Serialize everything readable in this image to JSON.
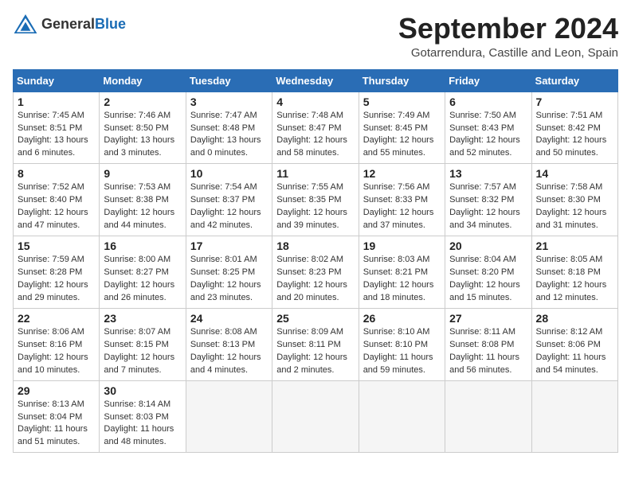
{
  "header": {
    "logo_general": "General",
    "logo_blue": "Blue",
    "month_title": "September 2024",
    "location": "Gotarrendura, Castille and Leon, Spain"
  },
  "calendar": {
    "headers": [
      "Sunday",
      "Monday",
      "Tuesday",
      "Wednesday",
      "Thursday",
      "Friday",
      "Saturday"
    ],
    "weeks": [
      [
        {
          "day": "1",
          "text": "Sunrise: 7:45 AM\nSunset: 8:51 PM\nDaylight: 13 hours\nand 6 minutes."
        },
        {
          "day": "2",
          "text": "Sunrise: 7:46 AM\nSunset: 8:50 PM\nDaylight: 13 hours\nand 3 minutes."
        },
        {
          "day": "3",
          "text": "Sunrise: 7:47 AM\nSunset: 8:48 PM\nDaylight: 13 hours\nand 0 minutes."
        },
        {
          "day": "4",
          "text": "Sunrise: 7:48 AM\nSunset: 8:47 PM\nDaylight: 12 hours\nand 58 minutes."
        },
        {
          "day": "5",
          "text": "Sunrise: 7:49 AM\nSunset: 8:45 PM\nDaylight: 12 hours\nand 55 minutes."
        },
        {
          "day": "6",
          "text": "Sunrise: 7:50 AM\nSunset: 8:43 PM\nDaylight: 12 hours\nand 52 minutes."
        },
        {
          "day": "7",
          "text": "Sunrise: 7:51 AM\nSunset: 8:42 PM\nDaylight: 12 hours\nand 50 minutes."
        }
      ],
      [
        {
          "day": "8",
          "text": "Sunrise: 7:52 AM\nSunset: 8:40 PM\nDaylight: 12 hours\nand 47 minutes."
        },
        {
          "day": "9",
          "text": "Sunrise: 7:53 AM\nSunset: 8:38 PM\nDaylight: 12 hours\nand 44 minutes."
        },
        {
          "day": "10",
          "text": "Sunrise: 7:54 AM\nSunset: 8:37 PM\nDaylight: 12 hours\nand 42 minutes."
        },
        {
          "day": "11",
          "text": "Sunrise: 7:55 AM\nSunset: 8:35 PM\nDaylight: 12 hours\nand 39 minutes."
        },
        {
          "day": "12",
          "text": "Sunrise: 7:56 AM\nSunset: 8:33 PM\nDaylight: 12 hours\nand 37 minutes."
        },
        {
          "day": "13",
          "text": "Sunrise: 7:57 AM\nSunset: 8:32 PM\nDaylight: 12 hours\nand 34 minutes."
        },
        {
          "day": "14",
          "text": "Sunrise: 7:58 AM\nSunset: 8:30 PM\nDaylight: 12 hours\nand 31 minutes."
        }
      ],
      [
        {
          "day": "15",
          "text": "Sunrise: 7:59 AM\nSunset: 8:28 PM\nDaylight: 12 hours\nand 29 minutes."
        },
        {
          "day": "16",
          "text": "Sunrise: 8:00 AM\nSunset: 8:27 PM\nDaylight: 12 hours\nand 26 minutes."
        },
        {
          "day": "17",
          "text": "Sunrise: 8:01 AM\nSunset: 8:25 PM\nDaylight: 12 hours\nand 23 minutes."
        },
        {
          "day": "18",
          "text": "Sunrise: 8:02 AM\nSunset: 8:23 PM\nDaylight: 12 hours\nand 20 minutes."
        },
        {
          "day": "19",
          "text": "Sunrise: 8:03 AM\nSunset: 8:21 PM\nDaylight: 12 hours\nand 18 minutes."
        },
        {
          "day": "20",
          "text": "Sunrise: 8:04 AM\nSunset: 8:20 PM\nDaylight: 12 hours\nand 15 minutes."
        },
        {
          "day": "21",
          "text": "Sunrise: 8:05 AM\nSunset: 8:18 PM\nDaylight: 12 hours\nand 12 minutes."
        }
      ],
      [
        {
          "day": "22",
          "text": "Sunrise: 8:06 AM\nSunset: 8:16 PM\nDaylight: 12 hours\nand 10 minutes."
        },
        {
          "day": "23",
          "text": "Sunrise: 8:07 AM\nSunset: 8:15 PM\nDaylight: 12 hours\nand 7 minutes."
        },
        {
          "day": "24",
          "text": "Sunrise: 8:08 AM\nSunset: 8:13 PM\nDaylight: 12 hours\nand 4 minutes."
        },
        {
          "day": "25",
          "text": "Sunrise: 8:09 AM\nSunset: 8:11 PM\nDaylight: 12 hours\nand 2 minutes."
        },
        {
          "day": "26",
          "text": "Sunrise: 8:10 AM\nSunset: 8:10 PM\nDaylight: 11 hours\nand 59 minutes."
        },
        {
          "day": "27",
          "text": "Sunrise: 8:11 AM\nSunset: 8:08 PM\nDaylight: 11 hours\nand 56 minutes."
        },
        {
          "day": "28",
          "text": "Sunrise: 8:12 AM\nSunset: 8:06 PM\nDaylight: 11 hours\nand 54 minutes."
        }
      ],
      [
        {
          "day": "29",
          "text": "Sunrise: 8:13 AM\nSunset: 8:04 PM\nDaylight: 11 hours\nand 51 minutes."
        },
        {
          "day": "30",
          "text": "Sunrise: 8:14 AM\nSunset: 8:03 PM\nDaylight: 11 hours\nand 48 minutes."
        },
        {
          "day": "",
          "text": ""
        },
        {
          "day": "",
          "text": ""
        },
        {
          "day": "",
          "text": ""
        },
        {
          "day": "",
          "text": ""
        },
        {
          "day": "",
          "text": ""
        }
      ]
    ]
  }
}
